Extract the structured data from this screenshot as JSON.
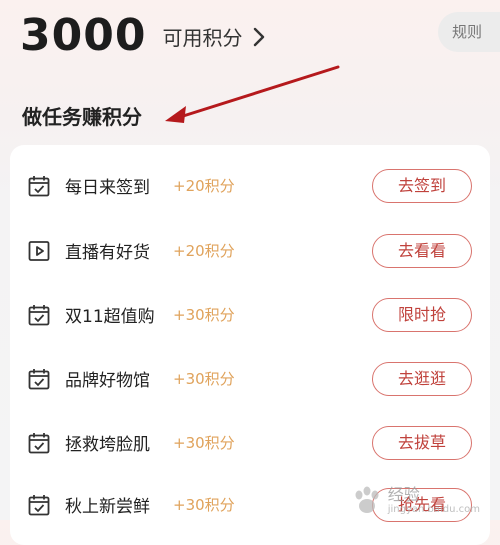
{
  "header": {
    "points_value": "3000",
    "points_label": "可用积分",
    "rules_label": "规则"
  },
  "section": {
    "title": "做任务赚积分"
  },
  "tasks": [
    {
      "name": "每日来签到",
      "reward": "+20积分",
      "button": "去签到",
      "icon": "calendar-check-icon"
    },
    {
      "name": "直播有好货",
      "reward": "+20积分",
      "button": "去看看",
      "icon": "play-icon"
    },
    {
      "name": "双11超值购",
      "reward": "+30积分",
      "button": "限时抢",
      "icon": "calendar-check-icon"
    },
    {
      "name": "品牌好物馆",
      "reward": "+30积分",
      "button": "去逛逛",
      "icon": "calendar-check-icon"
    },
    {
      "name": "拯救垮脸肌",
      "reward": "+30积分",
      "button": "去拔草",
      "icon": "calendar-check-icon"
    },
    {
      "name": "秋上新尝鲜",
      "reward": "+30积分",
      "button": "抢先看",
      "icon": "calendar-check-icon"
    }
  ],
  "watermark": {
    "text": "经验",
    "sub": "jingyan.baidu.com"
  },
  "colors": {
    "accent": "#c0423c",
    "button_border": "#d9746e",
    "reward": "#e0a35c",
    "annotation_arrow": "#b5191c"
  }
}
